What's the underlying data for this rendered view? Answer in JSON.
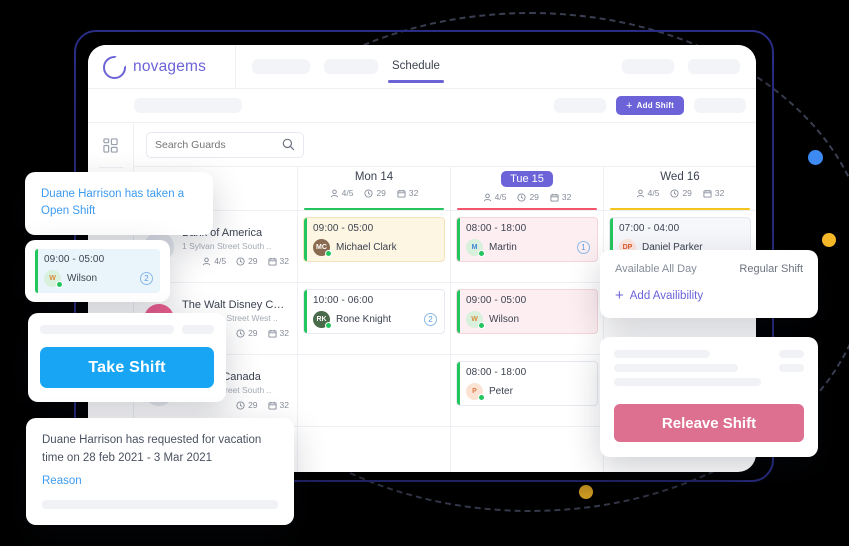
{
  "brand": {
    "name": "novagems",
    "logo_icon": "ring-logo-icon"
  },
  "topnav": {
    "active_tab": "Schedule",
    "ghost_tabs": [
      "",
      "",
      "",
      ""
    ]
  },
  "subbar": {
    "add_shift_label": "Add Shift",
    "add_shift_icon": "plus-icon",
    "add_shift_color": "#6c63d8"
  },
  "sidebar": {
    "items": [
      {
        "icon": "dashboard-grid-icon",
        "label": ""
      },
      {
        "icon": "binoculars-icon",
        "label": ""
      },
      {
        "icon": "id-card-icon",
        "label": ""
      },
      {
        "icon": "gear-icon",
        "label": ""
      }
    ]
  },
  "search": {
    "placeholder": "Search Guards",
    "value": "",
    "icon": "search-icon"
  },
  "days": [
    {
      "name": "Mon 14",
      "selected": false,
      "guards": "4/5",
      "hours": "29",
      "shifts": "32",
      "bar_color": "#22c55e"
    },
    {
      "name": "Tue 15",
      "selected": true,
      "guards": "4/5",
      "hours": "29",
      "shifts": "32",
      "bar_color": "#f2556c"
    },
    {
      "name": "Wed 16",
      "selected": false,
      "guards": "4/5",
      "hours": "29",
      "shifts": "32",
      "bar_color": "#f5c51f"
    }
  ],
  "stat_icons": {
    "guards": "person-icon",
    "hours": "clock-icon",
    "shifts": "calendar-icon"
  },
  "jobs": [
    {
      "name": "Bank of America",
      "address": "1 Sylvan Street South ..",
      "avatar_text": "B",
      "avatar_color": "#e7e9ef",
      "guards": "4/5",
      "hours": "29",
      "shifts": "32",
      "show_guards": true
    },
    {
      "name": "The Walt Disney Com..",
      "address": "972 Sylvan Street West ..",
      "avatar_text": "T",
      "avatar_color": "#ed5f8f",
      "guards": "",
      "hours": "29",
      "shifts": "32",
      "show_guards": false
    },
    {
      "name": "Bank of Canada",
      "address": "1 Sylvan Street South ..",
      "avatar_text": "B",
      "avatar_color": "#e7e9ef",
      "guards": "",
      "hours": "29",
      "shifts": "32",
      "show_guards": false
    }
  ],
  "shifts": {
    "mon": [
      {
        "time": "09:00 - 05:00",
        "person": "Michael Clark",
        "initials": "MC",
        "bg": "#fdf6e3",
        "border": "#f3e3bd",
        "accent": "#22c55e",
        "avatar_color": "#8a6a50",
        "avatar_text_color": "#ffffff",
        "count": ""
      },
      {
        "time": "10:00 - 06:00",
        "person": "Rone Knight",
        "initials": "RK",
        "bg": "#ffffff",
        "border": "#e6e9ef",
        "accent": "#22c55e",
        "avatar_color": "#4a6b4a",
        "avatar_text_color": "#ffffff",
        "count": "2"
      }
    ],
    "tue": [
      {
        "time": "08:00 - 18:00",
        "person": "Martin",
        "initials": "M",
        "bg": "#fdeef1",
        "border": "#f6d5dc",
        "accent": "#22c55e",
        "avatar_color": "#d8f0dc",
        "avatar_text_color": "#3e86d6",
        "count": "1"
      },
      {
        "time": "09:00 - 05:00",
        "person": "Wilson",
        "initials": "W",
        "bg": "#fdeef1",
        "border": "#f6d5dc",
        "accent": "#22c55e",
        "avatar_color": "#d8f0dc",
        "avatar_text_color": "#d98a3a",
        "count": ""
      },
      {
        "time": "08:00 - 18:00",
        "person": "Peter",
        "initials": "P",
        "bg": "#ffffff",
        "border": "#e6e9ef",
        "accent": "#22c55e",
        "avatar_color": "#fbe3d4",
        "avatar_text_color": "#e07a45",
        "count": ""
      }
    ],
    "wed": [
      {
        "time": "07:00 - 04:00",
        "person": "Daniel Parker",
        "initials": "DP",
        "bg": "#f6f7fb",
        "border": "#e6e9ef",
        "accent": "#22c55e",
        "avatar_color": "#fde6de",
        "avatar_text_color": "#e05a2b",
        "count": ""
      }
    ]
  },
  "overlays": {
    "open_shift": {
      "text": "Duane Harrison has taken a Open Shift",
      "color": "#3d9bf0"
    },
    "wilson_mini": {
      "time": "09:00 - 05:00",
      "person": "Wilson",
      "initials": "W",
      "count": "2"
    },
    "take_shift": {
      "label": "Take Shift",
      "color": "#18a6f4"
    },
    "vacation": {
      "text": "Duane Harrison has requested for vacation time on 28 feb 2021 - 3 Mar 2021",
      "reason_label": "Reason"
    },
    "availability": {
      "left_label": "Available All Day",
      "right_label": "Regular Shift",
      "add_label": "Add Availibility",
      "add_icon": "plus-icon",
      "accent": "#6c63d8"
    },
    "releave": {
      "label": "Releave Shift",
      "color": "#dd6f91"
    }
  },
  "decor": {
    "dot_blue": "#3d8bf2",
    "dot_amber": "#f5b829",
    "frame": "#2b2f8a"
  }
}
